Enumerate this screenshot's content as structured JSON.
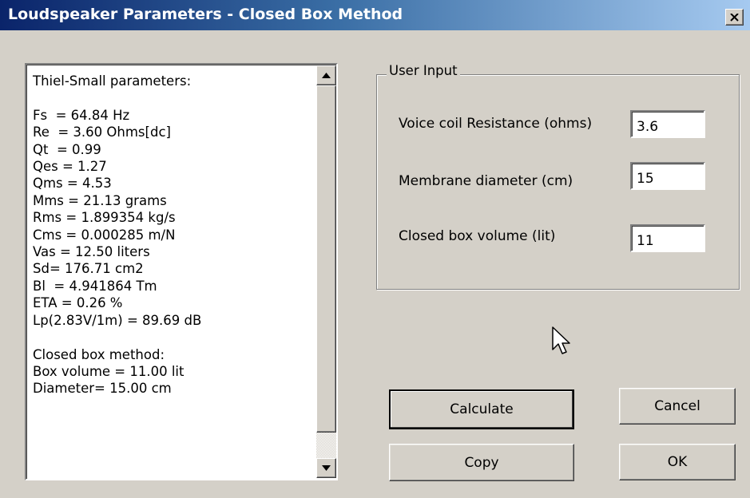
{
  "window": {
    "title": "Loudspeaker Parameters - Closed Box Method",
    "close_glyph": "x"
  },
  "results": {
    "lines": [
      "Thiel-Small parameters:",
      "",
      "Fs  = 64.84 Hz",
      "Re  = 3.60 Ohms[dc]",
      "Qt  = 0.99",
      "Qes = 1.27",
      "Qms = 4.53",
      "Mms = 21.13 grams",
      "Rms = 1.899354 kg/s",
      "Cms = 0.000285 m/N",
      "Vas = 12.50 liters",
      "Sd= 176.71 cm2",
      "Bl  = 4.941864 Tm",
      "ETA = 0.26 %",
      "Lp(2.83V/1m) = 89.69 dB",
      "",
      "Closed box method:",
      "Box volume = 11.00 lit",
      "Diameter= 15.00 cm"
    ]
  },
  "user_input": {
    "legend": "User Input",
    "fields": [
      {
        "label": "Voice coil Resistance (ohms)",
        "value": "3.6"
      },
      {
        "label": "Membrane diameter (cm)",
        "value": "15"
      },
      {
        "label": "Closed box volume (lit)",
        "value": "11"
      }
    ]
  },
  "buttons": {
    "calculate": "Calculate",
    "cancel": "Cancel",
    "copy": "Copy",
    "ok": "OK"
  },
  "icons": {
    "close": "close-icon",
    "scroll_up": "arrow-up-icon",
    "scroll_down": "arrow-down-icon",
    "cursor": "mouse-pointer-icon"
  }
}
